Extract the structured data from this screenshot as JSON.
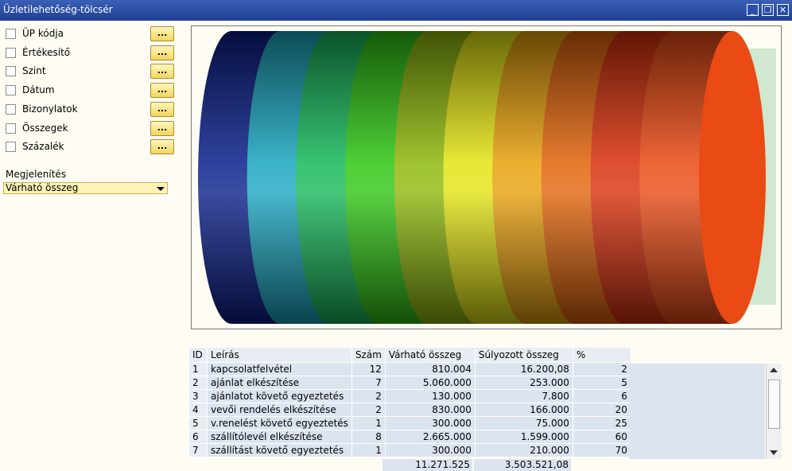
{
  "window": {
    "title": "Üzletilehetőség-tölcsér",
    "buttons": [
      "_",
      "❐",
      "✕"
    ]
  },
  "options": [
    {
      "label": "ÜP kódja",
      "button": "..."
    },
    {
      "label": "Értékesítő",
      "button": "..."
    },
    {
      "label": "Szint",
      "button": "..."
    },
    {
      "label": "Dátum",
      "button": "..."
    },
    {
      "label": "Bizonylatok",
      "button": "..."
    },
    {
      "label": "Összegek",
      "button": "..."
    },
    {
      "label": "Százalék",
      "button": "..."
    }
  ],
  "display": {
    "label": "Megjelenítés",
    "value": "Várható összeg"
  },
  "funnel": {
    "stage_colors": [
      "#0a1f8a",
      "#1aa6c0",
      "#16b85a",
      "#2fc614",
      "#8fb80c",
      "#e4e414",
      "#e8a00c",
      "#e2640a",
      "#d8300c",
      "#ea4a14"
    ]
  },
  "table": {
    "headers": [
      "ID",
      "Leírás",
      "Szám",
      "Várható összeg",
      "Súlyozott összeg",
      "%"
    ],
    "rows": [
      [
        "1",
        "kapcsolatfelvétel",
        "12",
        "810.004",
        "16.200,08",
        "2"
      ],
      [
        "2",
        "ajánlat elkészítése",
        "7",
        "5.060.000",
        "253.000",
        "5"
      ],
      [
        "3",
        "ajánlatot követő egyeztetés",
        "2",
        "130.000",
        "7.800",
        "6"
      ],
      [
        "4",
        "vevői rendelés elkészítése",
        "2",
        "830.000",
        "166.000",
        "20"
      ],
      [
        "5",
        "v.renelést követő egyeztetés",
        "1",
        "300.000",
        "75.000",
        "25"
      ],
      [
        "6",
        "szállítólevél elkészítése",
        "8",
        "2.665.000",
        "1.599.000",
        "60"
      ],
      [
        "7",
        "szállítást követő egyeztetés",
        "1",
        "300.000",
        "210.000",
        "70"
      ]
    ],
    "totals": {
      "expected": "11.271.525",
      "weighted": "3.503.521,08"
    }
  }
}
